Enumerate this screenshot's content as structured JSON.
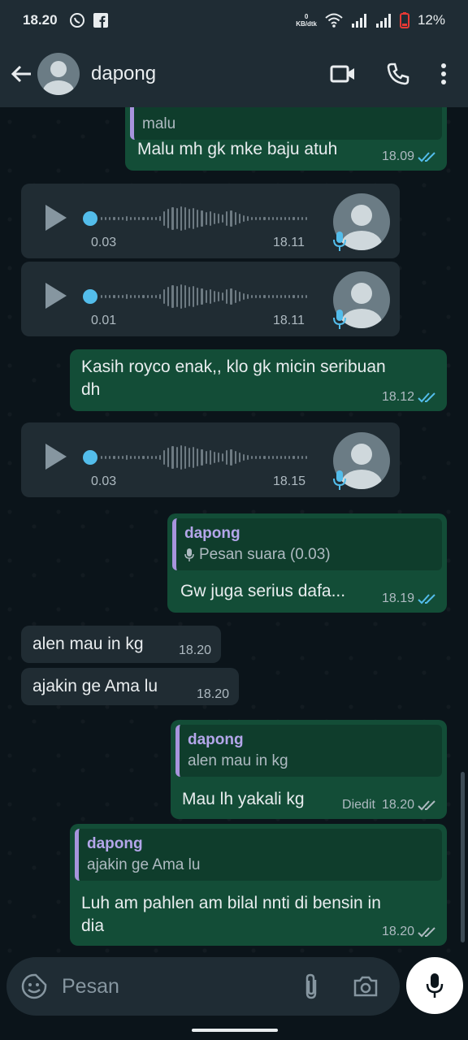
{
  "status_bar": {
    "time": "18.20",
    "speed_value": "0",
    "speed_unit": "KB/dtk",
    "battery": "12%"
  },
  "header": {
    "contact_name": "dapong"
  },
  "messages": {
    "m1": {
      "quote_text": "malu",
      "text": "Malu mh gk mke baju atuh",
      "time": "18.09"
    },
    "v1": {
      "duration": "0.03",
      "time": "18.11"
    },
    "v2": {
      "duration": "0.01",
      "time": "18.11"
    },
    "m2": {
      "text_line1": "Kasih royco enak,, klo gk micin seribuan",
      "text_line2": "dh",
      "time": "18.12"
    },
    "v3": {
      "duration": "0.03",
      "time": "18.15"
    },
    "m3": {
      "quote_name": "dapong",
      "quote_text": "Pesan suara (0.03)",
      "text": "Gw juga serius dafa...",
      "time": "18.19"
    },
    "m4": {
      "text": "alen mau in kg",
      "time": "18.20"
    },
    "m5": {
      "text": "ajakin ge Ama lu",
      "time": "18.20"
    },
    "m6": {
      "quote_name": "dapong",
      "quote_text": "alen mau in kg",
      "text": "Mau lh yakali kg",
      "edited": "Diedit",
      "time": "18.20"
    },
    "m7": {
      "quote_name": "dapong",
      "quote_text": "ajakin ge Ama lu",
      "text_line1": "Luh am pahlen am bilal nnti di bensin in",
      "text_line2": "dia",
      "time": "18.20"
    }
  },
  "input": {
    "placeholder": "Pesan"
  },
  "colors": {
    "outgoing_bubble": "#134d37",
    "incoming_bubble": "#202c33",
    "read_tick": "#53bdeb",
    "quote_accent": "#a794dd"
  }
}
